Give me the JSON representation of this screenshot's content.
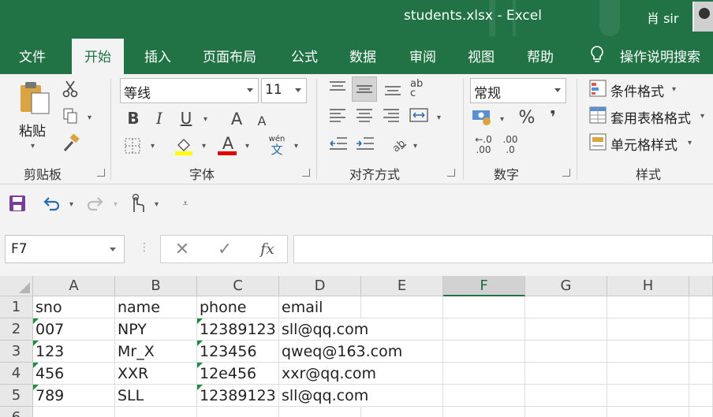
{
  "window": {
    "title": "students.xlsx  -  Excel",
    "user": "肖 sir"
  },
  "tabs": [
    "文件",
    "开始",
    "插入",
    "页面布局",
    "公式",
    "数据",
    "审阅",
    "视图",
    "帮助"
  ],
  "active_tab": "开始",
  "tell_me": "操作说明搜索",
  "ribbon": {
    "clipboard": {
      "paste_label": "粘贴",
      "group_label": "剪贴板"
    },
    "font": {
      "font_name": "等线",
      "font_size": "11",
      "bold": "B",
      "italic": "I",
      "underline": "U",
      "grow": "A",
      "shrink": "A",
      "font_color_glyph": "A",
      "phonetic_top": "wén",
      "phonetic_bottom": "文",
      "group_label": "字体"
    },
    "alignment": {
      "wrap_glyph": "ab c",
      "group_label": "对齐方式"
    },
    "number": {
      "format": "常规",
      "percent": "%",
      "comma": "❜",
      "inc_decimal": ".00",
      "dec_decimal": ".0",
      "group_label": "数字"
    },
    "styles": {
      "conditional": "条件格式",
      "table": "套用表格格式",
      "cell": "单元格样式",
      "group_label": "样式"
    }
  },
  "formula_bar": {
    "name_box": "F7",
    "cancel": "✕",
    "enter": "✓",
    "fx": "fx",
    "value": ""
  },
  "grid": {
    "columns": [
      "A",
      "B",
      "C",
      "D",
      "E",
      "F",
      "G",
      "H"
    ],
    "selected_column": "F",
    "row_numbers": [
      "1",
      "2",
      "3",
      "4",
      "5",
      "6"
    ],
    "rows": [
      [
        "sno",
        "name",
        "phone",
        "email"
      ],
      [
        "007",
        "NPY",
        "12389123",
        "sll@qq.com"
      ],
      [
        "123",
        "Mr_X",
        "123456",
        "qweq@163.com"
      ],
      [
        "456",
        "XXR",
        "12e456",
        "xxr@qq.com"
      ],
      [
        "789",
        "SLL",
        "12389123",
        "sll@qq.com"
      ]
    ]
  },
  "colors": {
    "excel_green": "#217346",
    "ribbon_bg": "#f3f3f3",
    "error_triangle": "#1e8c3e"
  }
}
